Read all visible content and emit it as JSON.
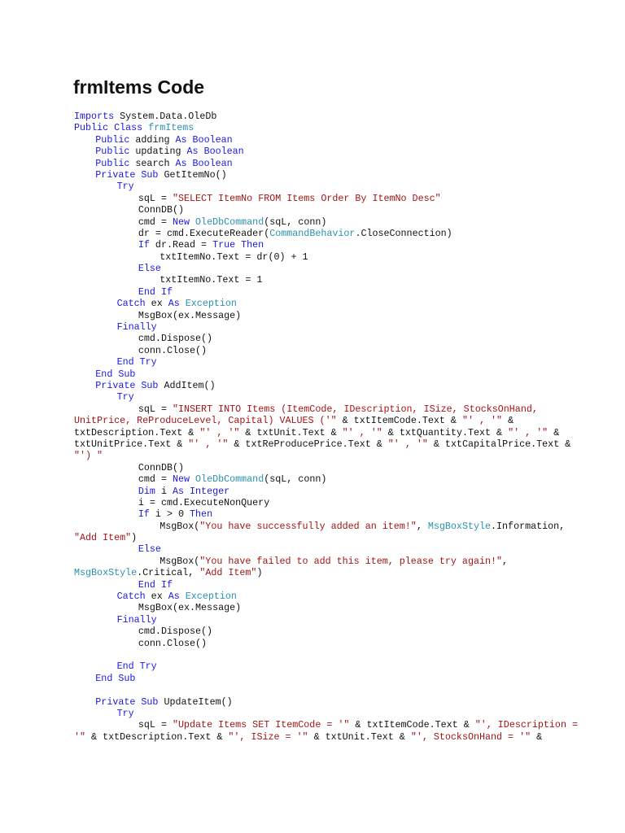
{
  "title": "frmItems Code",
  "colors": {
    "keyword": "#1a1ae0",
    "type": "#2b91af",
    "string": "#a31515",
    "plain": "#111111"
  },
  "lines": [
    {
      "indent": 0,
      "tokens": [
        [
          "k",
          "Imports"
        ],
        [
          "p",
          " System.Data.OleDb"
        ]
      ]
    },
    {
      "indent": 0,
      "tokens": [
        [
          "k",
          "Public Class "
        ],
        [
          "t",
          "frmItems"
        ]
      ]
    },
    {
      "indent": 1,
      "tokens": [
        [
          "k",
          "Public"
        ],
        [
          "p",
          " adding "
        ],
        [
          "k",
          "As Boolean"
        ]
      ]
    },
    {
      "indent": 1,
      "tokens": [
        [
          "k",
          "Public"
        ],
        [
          "p",
          " updating "
        ],
        [
          "k",
          "As Boolean"
        ]
      ]
    },
    {
      "indent": 1,
      "tokens": [
        [
          "k",
          "Public"
        ],
        [
          "p",
          " search "
        ],
        [
          "k",
          "As Boolean"
        ]
      ]
    },
    {
      "indent": 1,
      "tokens": [
        [
          "k",
          "Private Sub"
        ],
        [
          "p",
          " GetItemNo()"
        ]
      ]
    },
    {
      "indent": 2,
      "tokens": [
        [
          "k",
          "Try"
        ]
      ]
    },
    {
      "indent": 3,
      "tokens": [
        [
          "p",
          "sqL = "
        ],
        [
          "s",
          "\"SELECT ItemNo FROM Items Order By ItemNo Desc\""
        ]
      ]
    },
    {
      "indent": 3,
      "tokens": [
        [
          "p",
          "ConnDB()"
        ]
      ]
    },
    {
      "indent": 3,
      "tokens": [
        [
          "p",
          "cmd = "
        ],
        [
          "k",
          "New"
        ],
        [
          "p",
          " "
        ],
        [
          "t",
          "OleDbCommand"
        ],
        [
          "p",
          "(sqL, conn)"
        ]
      ]
    },
    {
      "indent": 3,
      "tokens": [
        [
          "p",
          "dr = cmd.ExecuteReader("
        ],
        [
          "t",
          "CommandBehavior"
        ],
        [
          "p",
          ".CloseConnection)"
        ]
      ]
    },
    {
      "indent": 3,
      "tokens": [
        [
          "k",
          "If"
        ],
        [
          "p",
          " dr.Read = "
        ],
        [
          "k",
          "True Then"
        ]
      ]
    },
    {
      "indent": 4,
      "tokens": [
        [
          "p",
          "txtItemNo.Text = dr(0) + 1"
        ]
      ]
    },
    {
      "indent": 3,
      "tokens": [
        [
          "k",
          "Else"
        ]
      ]
    },
    {
      "indent": 4,
      "tokens": [
        [
          "p",
          "txtItemNo.Text = 1"
        ]
      ]
    },
    {
      "indent": 3,
      "tokens": [
        [
          "k",
          "End If"
        ]
      ]
    },
    {
      "indent": 2,
      "tokens": [
        [
          "k",
          "Catch"
        ],
        [
          "p",
          " ex "
        ],
        [
          "k",
          "As"
        ],
        [
          "p",
          " "
        ],
        [
          "t",
          "Exception"
        ]
      ]
    },
    {
      "indent": 3,
      "tokens": [
        [
          "p",
          "MsgBox(ex.Message)"
        ]
      ]
    },
    {
      "indent": 2,
      "tokens": [
        [
          "k",
          "Finally"
        ]
      ]
    },
    {
      "indent": 3,
      "tokens": [
        [
          "p",
          "cmd.Dispose()"
        ]
      ]
    },
    {
      "indent": 3,
      "tokens": [
        [
          "p",
          "conn.Close()"
        ]
      ]
    },
    {
      "indent": 2,
      "tokens": [
        [
          "k",
          "End Try"
        ]
      ]
    },
    {
      "indent": 1,
      "tokens": [
        [
          "k",
          "End Sub"
        ]
      ]
    },
    {
      "indent": 1,
      "tokens": [
        [
          "k",
          "Private Sub"
        ],
        [
          "p",
          " AddItem()"
        ]
      ]
    },
    {
      "indent": 2,
      "tokens": [
        [
          "k",
          "Try"
        ]
      ]
    },
    {
      "indent": 3,
      "tokens": [
        [
          "p",
          "sqL = "
        ],
        [
          "s",
          "\"INSERT INTO Items (ItemCode, IDescription, ISize, StocksOnHand,"
        ]
      ]
    },
    {
      "indent": 0,
      "tokens": [
        [
          "s",
          "UnitPrice, ReProduceLevel, Capital) VALUES ('\""
        ],
        [
          "p",
          " & txtItemCode.Text & "
        ],
        [
          "s",
          "\"' , '\""
        ],
        [
          "p",
          " &"
        ]
      ]
    },
    {
      "indent": 0,
      "tokens": [
        [
          "p",
          "txtDescription.Text & "
        ],
        [
          "s",
          "\"' , '\""
        ],
        [
          "p",
          " & txtUnit.Text & "
        ],
        [
          "s",
          "\"' , '\""
        ],
        [
          "p",
          " & txtQuantity.Text & "
        ],
        [
          "s",
          "\"' , '\""
        ],
        [
          "p",
          " &"
        ]
      ]
    },
    {
      "indent": 0,
      "tokens": [
        [
          "p",
          "txtUnitPrice.Text & "
        ],
        [
          "s",
          "\"' , '\""
        ],
        [
          "p",
          " & txtReProducePrice.Text & "
        ],
        [
          "s",
          "\"' , '\""
        ],
        [
          "p",
          " & txtCapitalPrice.Text &"
        ]
      ]
    },
    {
      "indent": 0,
      "tokens": [
        [
          "s",
          "\"') \""
        ]
      ]
    },
    {
      "indent": 3,
      "tokens": [
        [
          "p",
          "ConnDB()"
        ]
      ]
    },
    {
      "indent": 3,
      "tokens": [
        [
          "p",
          "cmd = "
        ],
        [
          "k",
          "New"
        ],
        [
          "p",
          " "
        ],
        [
          "t",
          "OleDbCommand"
        ],
        [
          "p",
          "(sqL, conn)"
        ]
      ]
    },
    {
      "indent": 3,
      "tokens": [
        [
          "k",
          "Dim"
        ],
        [
          "p",
          " i "
        ],
        [
          "k",
          "As Integer"
        ]
      ]
    },
    {
      "indent": 3,
      "tokens": [
        [
          "p",
          "i = cmd.ExecuteNonQuery"
        ]
      ]
    },
    {
      "indent": 3,
      "tokens": [
        [
          "k",
          "If"
        ],
        [
          "p",
          " i > 0 "
        ],
        [
          "k",
          "Then"
        ]
      ]
    },
    {
      "indent": 4,
      "tokens": [
        [
          "p",
          "MsgBox("
        ],
        [
          "s",
          "\"You have successfully added an item!\""
        ],
        [
          "p",
          ", "
        ],
        [
          "t",
          "MsgBoxStyle"
        ],
        [
          "p",
          ".Information,"
        ]
      ]
    },
    {
      "indent": 0,
      "tokens": [
        [
          "s",
          "\"Add Item\""
        ],
        [
          "p",
          ")"
        ]
      ]
    },
    {
      "indent": 3,
      "tokens": [
        [
          "k",
          "Else"
        ]
      ]
    },
    {
      "indent": 4,
      "tokens": [
        [
          "p",
          "MsgBox("
        ],
        [
          "s",
          "\"You have failed to add this item, please try again!\""
        ],
        [
          "p",
          ","
        ]
      ]
    },
    {
      "indent": 0,
      "tokens": [
        [
          "t",
          "MsgBoxStyle"
        ],
        [
          "p",
          ".Critical, "
        ],
        [
          "s",
          "\"Add Item\""
        ],
        [
          "p",
          ")"
        ]
      ]
    },
    {
      "indent": 3,
      "tokens": [
        [
          "k",
          "End If"
        ]
      ]
    },
    {
      "indent": 2,
      "tokens": [
        [
          "k",
          "Catch"
        ],
        [
          "p",
          " ex "
        ],
        [
          "k",
          "As"
        ],
        [
          "p",
          " "
        ],
        [
          "t",
          "Exception"
        ]
      ]
    },
    {
      "indent": 3,
      "tokens": [
        [
          "p",
          "MsgBox(ex.Message)"
        ]
      ]
    },
    {
      "indent": 2,
      "tokens": [
        [
          "k",
          "Finally"
        ]
      ]
    },
    {
      "indent": 3,
      "tokens": [
        [
          "p",
          "cmd.Dispose()"
        ]
      ]
    },
    {
      "indent": 3,
      "tokens": [
        [
          "p",
          "conn.Close()"
        ]
      ]
    },
    {
      "indent": 0,
      "tokens": []
    },
    {
      "indent": 2,
      "tokens": [
        [
          "k",
          "End Try"
        ]
      ]
    },
    {
      "indent": 1,
      "tokens": [
        [
          "k",
          "End Sub"
        ]
      ]
    },
    {
      "indent": 0,
      "tokens": []
    },
    {
      "indent": 1,
      "tokens": [
        [
          "k",
          "Private Sub"
        ],
        [
          "p",
          " UpdateItem()"
        ]
      ]
    },
    {
      "indent": 2,
      "tokens": [
        [
          "k",
          "Try"
        ]
      ]
    },
    {
      "indent": 3,
      "tokens": [
        [
          "p",
          "sqL = "
        ],
        [
          "s",
          "\"Update Items SET ItemCode = '\""
        ],
        [
          "p",
          " & txtItemCode.Text & "
        ],
        [
          "s",
          "\"', IDescription ="
        ]
      ]
    },
    {
      "indent": 0,
      "tokens": [
        [
          "s",
          "'\""
        ],
        [
          "p",
          " & txtDescription.Text & "
        ],
        [
          "s",
          "\"', ISize = '\""
        ],
        [
          "p",
          " & txtUnit.Text & "
        ],
        [
          "s",
          "\"', StocksOnHand = '\""
        ],
        [
          "p",
          " &"
        ]
      ]
    }
  ]
}
